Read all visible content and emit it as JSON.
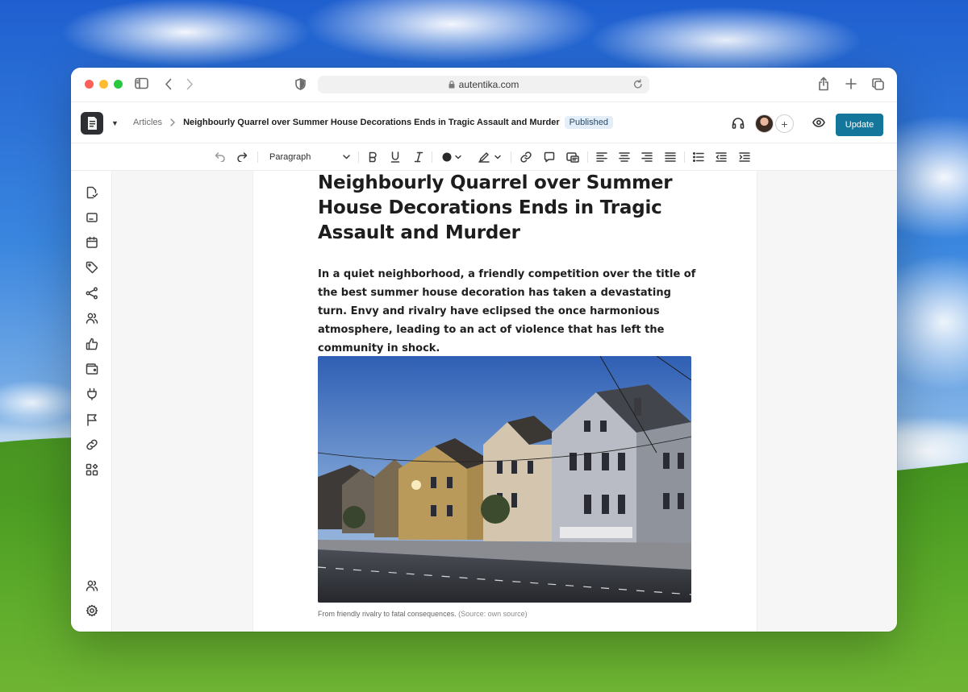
{
  "browser": {
    "url": "autentika.com",
    "traffic_colors": [
      "#ff5f57",
      "#febc2e",
      "#28c840"
    ]
  },
  "header": {
    "breadcrumb_root": "Articles",
    "breadcrumb_current": "Neighbourly Quarrel over Summer House Decorations Ends in Tragic Assault and Murder",
    "status_badge": "Published",
    "update_label": "Update",
    "accent": "#13769a"
  },
  "toolbar": {
    "block_style": "Paragraph"
  },
  "article": {
    "title": "Neighbourly Quarrel over Summer House Decorations Ends in Tragic Assault and Murder",
    "lede": "In a quiet neighborhood, a friendly competition over the title of the best summer house decoration has taken a devastating turn. Envy and rivalry have eclipsed the once harmonious atmosphere, leading to an act of violence that has left the community in shock.",
    "caption": "From friendly rivalry to fatal consequences.",
    "caption_source": "(Source: own source)"
  },
  "sidebar": {
    "icons": [
      "document-check-icon",
      "inbox-icon",
      "calendar-icon",
      "tag-icon",
      "share-icon",
      "users-icon",
      "thumbs-up-icon",
      "wallet-icon",
      "plug-icon",
      "flag-icon",
      "link-icon",
      "widgets-icon"
    ],
    "bottom_icons": [
      "team-icon",
      "settings-icon"
    ]
  }
}
